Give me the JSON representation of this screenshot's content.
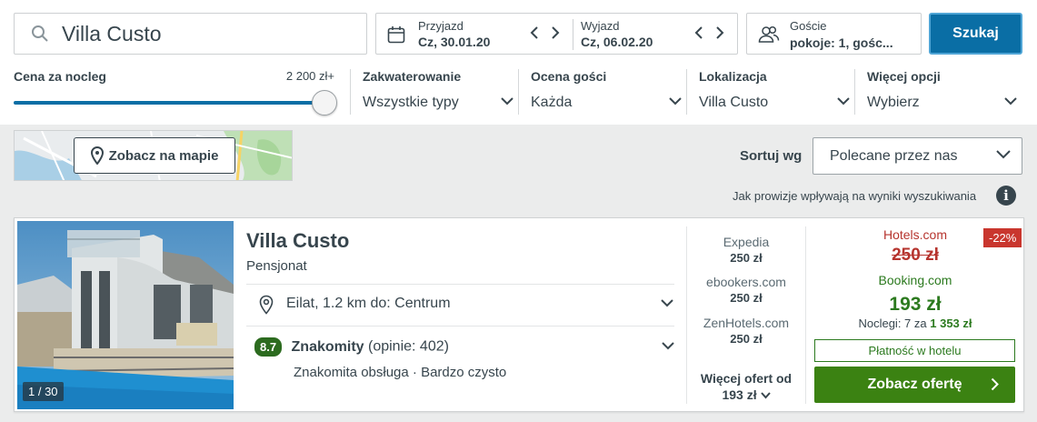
{
  "search": {
    "query": "Villa Custo",
    "button_label": "Szukaj"
  },
  "dates": {
    "checkin_label": "Przyjazd",
    "checkin_value": "Cz, 30.01.20",
    "checkout_label": "Wyjazd",
    "checkout_value": "Cz, 06.02.20"
  },
  "guests": {
    "label": "Goście",
    "value": "pokoje: 1, gośc..."
  },
  "filters": {
    "price": {
      "label": "Cena za nocleg",
      "max_label": "2 200 zł+",
      "slider_level_fraction": 1.0
    },
    "items": [
      {
        "label": "Zakwaterowanie",
        "value": "Wszystkie typy"
      },
      {
        "label": "Ocena gości",
        "value": "Każda"
      },
      {
        "label": "Lokalizacja",
        "value": "Villa Custo"
      },
      {
        "label": "Więcej opcji",
        "value": "Wybierz"
      }
    ]
  },
  "map": {
    "button_label": "Zobacz na mapie"
  },
  "sort": {
    "label": "Sortuj wg",
    "value": "Polecane przez nas"
  },
  "commission_note": "Jak prowizje wpływają na wyniki wyszukiwania",
  "result": {
    "name": "Villa Custo",
    "type": "Pensjonat",
    "photo_counter": "1 / 30",
    "location": "Eilat, 1.2 km do: Centrum",
    "rating": {
      "score": "8.7",
      "word": "Znakomity",
      "reviews": "(opinie: 402)"
    },
    "perks": "Znakomita obsługa · Bardzo czysto",
    "offers": [
      {
        "provider": "Expedia",
        "price": "250 zł"
      },
      {
        "provider": "ebookers.com",
        "price": "250 zł"
      },
      {
        "provider": "ZenHotels.com",
        "price": "250 zł"
      }
    ],
    "more_offers_label": "Więcej ofert od",
    "more_offers_price": "193 zł",
    "top_offer": {
      "strike_provider": "Hotels.com",
      "strike_price": "250 zł",
      "discount": "-22%",
      "provider": "Booking.com",
      "price": "193 zł",
      "nights_text": "Noclegi: 7 za",
      "nights_total": "1 353 zł",
      "pay_at_hotel": "Płatność w hotelu",
      "cta_label": "Zobacz ofertę"
    }
  },
  "colors": {
    "text": "#37454d",
    "accent_blue": "#0a6ea5",
    "green": "#2c7a1f",
    "cta_green": "#3b8212",
    "red": "#b6342e"
  }
}
